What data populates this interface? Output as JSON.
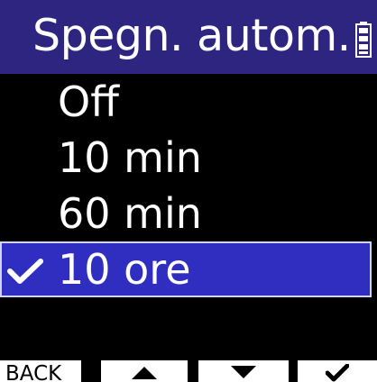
{
  "header": {
    "title": "Spegn. autom.",
    "battery_icon": "battery-icon"
  },
  "menu": {
    "items": [
      {
        "label": "Off",
        "selected": false
      },
      {
        "label": "10 min",
        "selected": false
      },
      {
        "label": "60 min",
        "selected": false
      },
      {
        "label": "10 ore",
        "selected": true
      }
    ],
    "selected_icon": "checkmark-icon"
  },
  "softkeys": {
    "back_label": "BACK",
    "up_icon": "up-arrow-icon",
    "down_icon": "down-arrow-icon",
    "enter_icon": "checkmark-icon"
  },
  "colors": {
    "title_bar": "#2d257f",
    "screen_background": "#000000",
    "selection": "#2f2ec0",
    "softkey_background": "#ffffff",
    "text": "#ffffff"
  }
}
